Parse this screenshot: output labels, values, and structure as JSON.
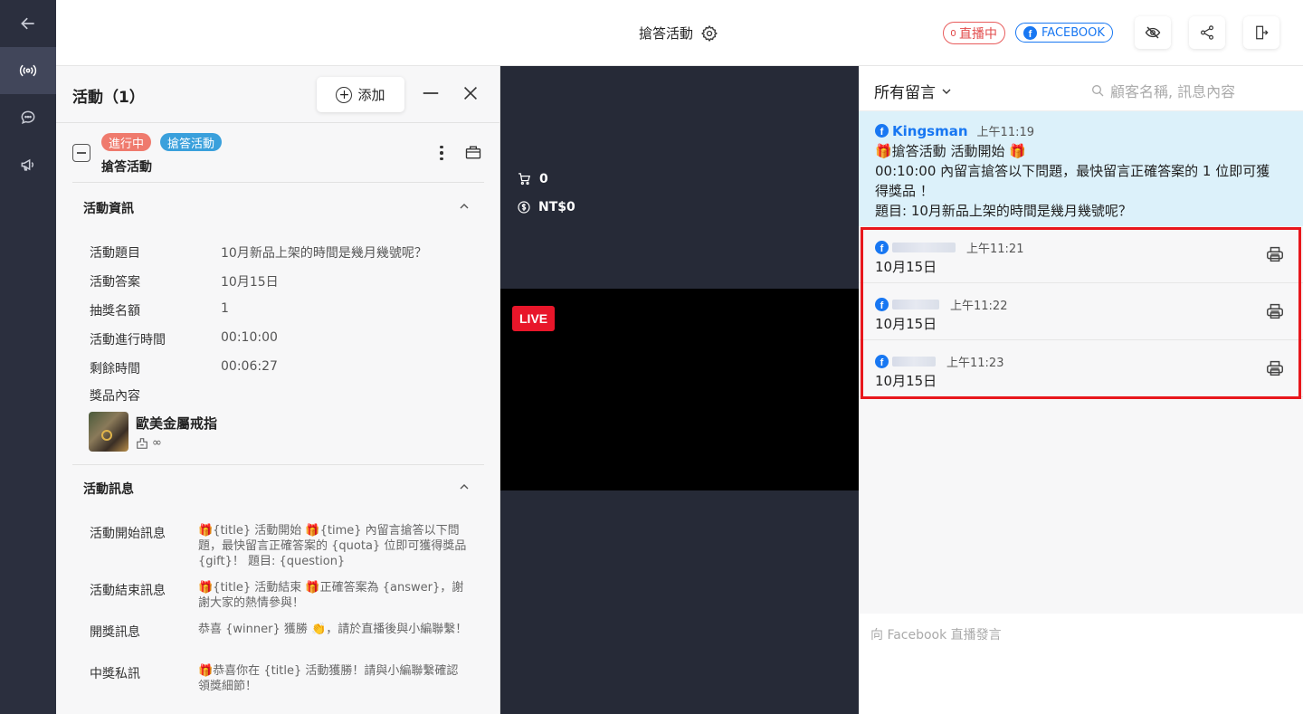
{
  "rail": {
    "items": [
      {
        "name": "back-arrow-icon"
      },
      {
        "name": "broadcast-icon"
      },
      {
        "name": "chat-bubble-icon"
      },
      {
        "name": "megaphone-icon"
      }
    ]
  },
  "topbar": {
    "title": "搶答活動",
    "live_badge": "直播中",
    "platform_badge": "FACEBOOK"
  },
  "panel": {
    "title": "活動（1）",
    "add_label": "添加",
    "activity": {
      "status_tag": "進行中",
      "type_tag": "搶答活動",
      "name": "搶答活動"
    },
    "info_section": {
      "title": "活動資訊",
      "rows": [
        {
          "label": "活動題目",
          "value": "10月新品上架的時間是幾月幾號呢？"
        },
        {
          "label": "活動答案",
          "value": "10月15日"
        },
        {
          "label": "抽獎名額",
          "value": "1"
        },
        {
          "label": "活動進行時間",
          "value": "00:10:00"
        },
        {
          "label": "剩餘時間",
          "value": "00:06:27"
        }
      ],
      "prize_label": "獎品內容",
      "prize_name": "歐美金屬戒指",
      "prize_stock": "∞"
    },
    "message_section": {
      "title": "活動訊息",
      "rows": [
        {
          "label": "活動開始訊息",
          "value": "🎁{title} 活動開始 🎁{time} 內留言搶答以下問題，最快留言正確答案的 {quota} 位即可獲得獎品 {gift}！ 題目: {question}"
        },
        {
          "label": "活動結束訊息",
          "value": "🎁{title} 活動結束 🎁正確答案為 {answer}，謝謝大家的熱情參與！"
        },
        {
          "label": "開獎訊息",
          "value": "恭喜 {winner} 獲勝 👏，請於直播後與小編聯繫！"
        },
        {
          "label": "中獎私訊",
          "value": "🎁恭喜你在 {title} 活動獲勝！請與小編聯繫確認領獎細節！"
        }
      ]
    }
  },
  "stream": {
    "cart_count": "0",
    "revenue": "NT$0",
    "live_label": "LIVE"
  },
  "comments": {
    "filter": "所有留言",
    "search_placeholder": "顧客名稱, 訊息內容",
    "pinned": {
      "author": "Kingsman",
      "time": "上午11:19",
      "line1": "🎁搶答活動 活動開始 🎁",
      "line2": "00:10:00 內留言搶答以下問題，最快留言正確答案的 1 位即可獲得獎品 ！",
      "line3": "題目: 10月新品上架的時間是幾月幾號呢？"
    },
    "items": [
      {
        "time": "上午11:21",
        "text": "10月15日"
      },
      {
        "time": "上午11:22",
        "text": "10月15日"
      },
      {
        "time": "上午11:23",
        "text": "10月15日"
      }
    ],
    "input_placeholder": "向 Facebook 直播發言"
  },
  "colors": {
    "rail_bg": "#2b2f3e",
    "stream_bg": "#262a37",
    "status_tag": "#ef7a6d",
    "type_tag": "#3aa0dc",
    "facebook": "#1877f2",
    "live_red": "#e8162a",
    "highlight": "#e8171c",
    "pinned_bg": "#dcf1fa"
  }
}
